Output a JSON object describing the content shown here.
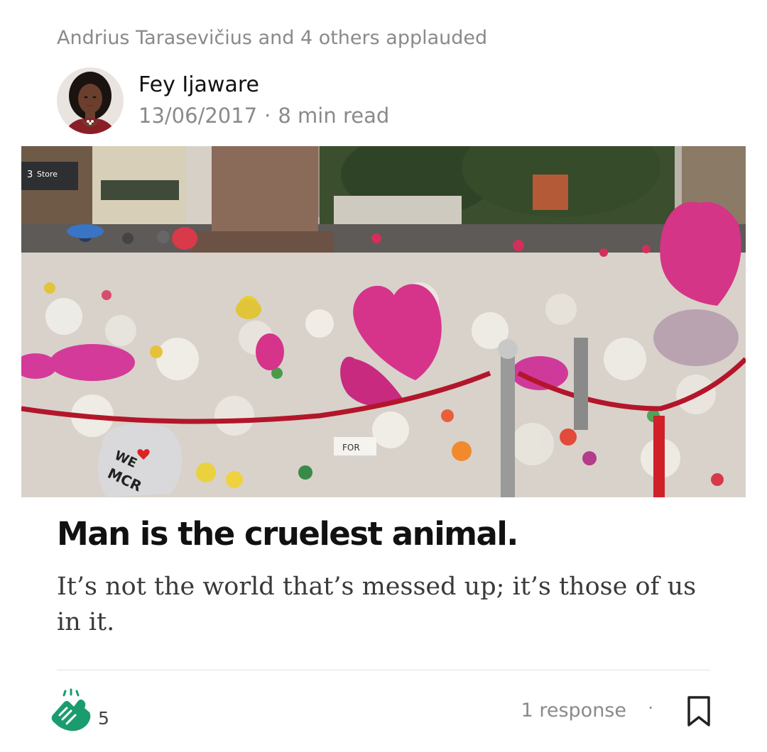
{
  "header": {
    "applause_text": "Andrius Tarasevičius and 4 others applauded"
  },
  "author": {
    "name": "Fey Ijaware",
    "date": "13/06/2017",
    "separator": "·",
    "read_time": "8 min read"
  },
  "hero_image": {
    "description_icon": "photo-memorial-flowers",
    "visible_text": [
      "Store",
      "WE ♥ MCR",
      "FOR"
    ]
  },
  "article": {
    "title": "Man is the cruelest animal.",
    "subtitle": "It’s not the world that’s messed up; it’s those of us in it."
  },
  "footer": {
    "clap_icon": "clap-icon",
    "clap_count": "5",
    "responses_label": "1 response",
    "separator": "·",
    "bookmark_icon": "bookmark-icon"
  },
  "colors": {
    "clap_green": "#1a9c6e",
    "muted_text": "#8a8a8a",
    "divider": "#e0e0e0"
  }
}
